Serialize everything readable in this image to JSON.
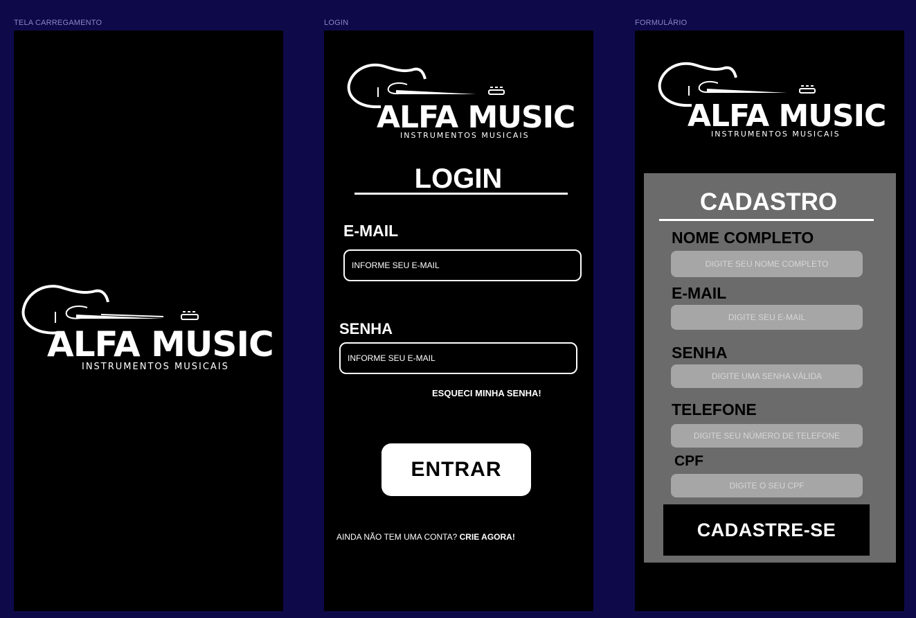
{
  "frames": {
    "loading": {
      "label": "TELA CARREGAMENTO"
    },
    "login": {
      "label": "LOGIN"
    },
    "form": {
      "label": "FORMULÁRIO"
    }
  },
  "logo": {
    "brand": "ALFA MUSIC",
    "tagline": "INSTRUMENTOS MUSICAIS"
  },
  "login": {
    "title": "LOGIN",
    "email_label": "E-MAIL",
    "email_placeholder": "INFORME SEU E-MAIL",
    "password_label": "SENHA",
    "password_placeholder": "INFORME SEU E-MAIL",
    "forgot": "ESQUECI MINHA SENHA!",
    "submit": "ENTRAR",
    "no_account": "AINDA NÃO TEM UMA CONTA?",
    "create_link": "CRIE AGORA!"
  },
  "register": {
    "title": "CADASTRO",
    "name_label": "NOME COMPLETO",
    "name_placeholder": "DIGITE SEU NOME COMPLETO",
    "email_label": "E-MAIL",
    "email_placeholder": "DIGITE SEU E-MAIL",
    "password_label": "SENHA",
    "password_placeholder": "DIGITE UMA SENHA VÁLIDA",
    "phone_label": "TELEFONE",
    "phone_placeholder": "DIGITE SEU NÚMERO DE TELEFONE",
    "cpf_label": "CPF",
    "cpf_placeholder": "DIGITE O SEU CPF",
    "submit": "CADASTRE-SE"
  },
  "colors": {
    "background": "#0e0a4a",
    "frame": "#000000",
    "panel": "#6b6b6b",
    "input_fill": "#a6a6a6"
  }
}
